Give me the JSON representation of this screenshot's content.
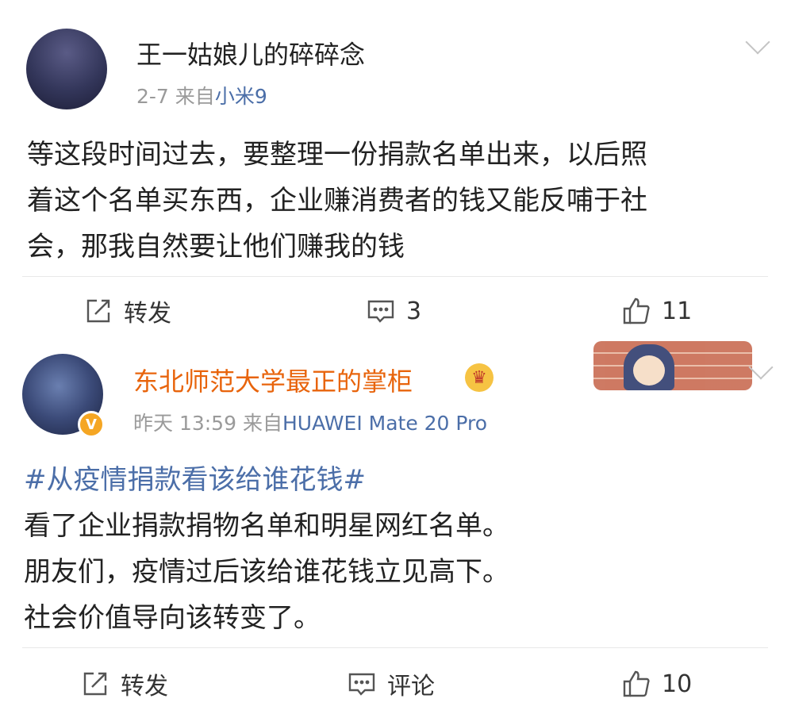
{
  "posts": [
    {
      "username": "王一姑娘儿的碎碎念",
      "date": "2-7",
      "from_label": "来自",
      "source": "小米9",
      "content_lines": [
        "等这段时间过去，要整理一份捐款名单出来，以后照",
        "着这个名单买东西，企业赚消费者的钱又能反哺于社",
        "会，那我自然要让他们赚我的钱"
      ],
      "actions": {
        "repost": "转发",
        "comment": "3",
        "like": "11"
      }
    },
    {
      "username": "东北师范大学最正的掌柜",
      "date": "昨天 13:59",
      "from_label": "来自",
      "source": "HUAWEI Mate 20 Pro",
      "topic": "#从疫情捐款看该给谁花钱#",
      "content_lines": [
        "看了企业捐款捐物名单和明星网红名单。",
        "朋友们，疫情过后该给谁花钱立见高下。",
        "社会价值导向该转变了。"
      ],
      "actions": {
        "repost": "转发",
        "comment": "评论",
        "like": "10"
      }
    }
  ],
  "icons": [
    "repost-icon",
    "comment-icon",
    "like-icon",
    "chevron-down-icon",
    "verified-badge-icon",
    "crown-icon"
  ],
  "colors": {
    "username_highlight": "#e8640c",
    "link": "#4b6ea8",
    "meta": "#9a9a9a",
    "verified": "#f5a623"
  }
}
